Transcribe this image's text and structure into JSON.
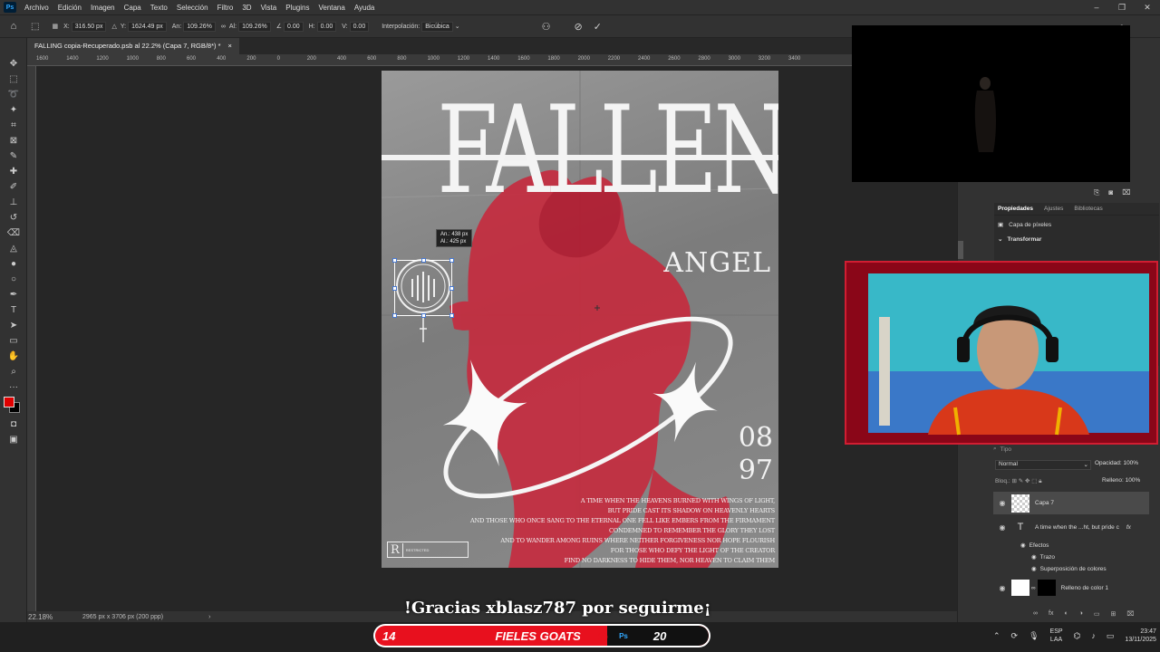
{
  "menubar": {
    "items": [
      "Archivo",
      "Edición",
      "Imagen",
      "Capa",
      "Texto",
      "Selección",
      "Filtro",
      "3D",
      "Vista",
      "Plugins",
      "Ventana",
      "Ayuda"
    ],
    "app_icon": "Ps"
  },
  "options": {
    "x_label": "X:",
    "x": "316.50 px",
    "y_label": "Y:",
    "y": "1624.49 px",
    "w_label": "An:",
    "w": "109.26%",
    "h_label": "Al:",
    "h": "109.26%",
    "angle": "0.00",
    "hskew_label": "H:",
    "hskew": "0.00",
    "vskew_label": "V:",
    "vskew": "0.00",
    "interp_label": "Interpolación:",
    "interp": "Bicúbica"
  },
  "tab": {
    "title": "FALLING copia-Recuperado.psb al 22.2% (Capa 7, RGB/8*) *",
    "close": "×"
  },
  "ruler": {
    "ticks": [
      "1600",
      "1400",
      "1200",
      "1000",
      "800",
      "600",
      "400",
      "200",
      "0",
      "200",
      "400",
      "600",
      "800",
      "1000",
      "1200",
      "1400",
      "1600",
      "1800",
      "2000",
      "2200",
      "2400",
      "2600",
      "2800",
      "3000",
      "3200",
      "3400"
    ]
  },
  "poster": {
    "title": "FALLEN",
    "subtitle": "ANGEL",
    "date1": "08",
    "date2": "97",
    "verse": [
      "A TIME WHEN THE HEAVENS BURNED WITH WINGS OF LIGHT,",
      "BUT PRIDE CAST ITS SHADOW ON HEAVENLY HEARTS",
      "AND THOSE WHO ONCE SANG TO THE ETERNAL ONE FELL LIKE EMBERS FROM THE FIRMAMENT",
      "CONDEMNED TO REMEMBER THE GLORY THEY LOST",
      "AND TO WANDER AMONG RUINS WHERE NEITHER FORGIVENESS NOR HOPE FLOURISH",
      "FOR THOSE WHO DEFY THE LIGHT OF THE CREATOR",
      "FIND NO DARKNESS TO HIDE THEM, NOR HEAVEN TO CLAIM THEM"
    ],
    "rating": "R",
    "rating_text": "RESTRICTED"
  },
  "transform_tip": {
    "w": "An.:  438 px",
    "h": "Al.:  425 px"
  },
  "status": {
    "zoom": "22.18%",
    "size": "2965 px x 3706 px (200 ppp)"
  },
  "props": {
    "tabs": [
      "Propiedades",
      "Ajustes",
      "Bibliotecas"
    ],
    "kind": "Capa de píxeles",
    "section": "Transformar"
  },
  "layers": {
    "search": "Tipo",
    "blend": "Normal",
    "opacity_label": "Opacidad:",
    "opacity": "100%",
    "fill_label": "Relleno:",
    "fill": "100%",
    "lock_label": "Bloq.:",
    "items": [
      {
        "name": "Capa 7"
      },
      {
        "name": "A time when the ...ht, but pride c",
        "fx": "fx"
      },
      {
        "name": "Efectos"
      },
      {
        "name": "Trazo"
      },
      {
        "name": "Superposición de colores"
      },
      {
        "name": "Relleno de color 1"
      }
    ]
  },
  "stream": {
    "thanks": "!Gracias xblasz787 por seguirme¡",
    "left_num": "14",
    "goal": "FIELES GOATS",
    "right_num": "20"
  },
  "taskbar": {
    "lang": "ESP",
    "lang2": "LAA",
    "time": "23:47",
    "date": "13/11/2025"
  },
  "colors": {
    "fg": "#e00000",
    "bg": "#000000",
    "accent": "#31a8ff",
    "poster_red": "#c8283c"
  }
}
